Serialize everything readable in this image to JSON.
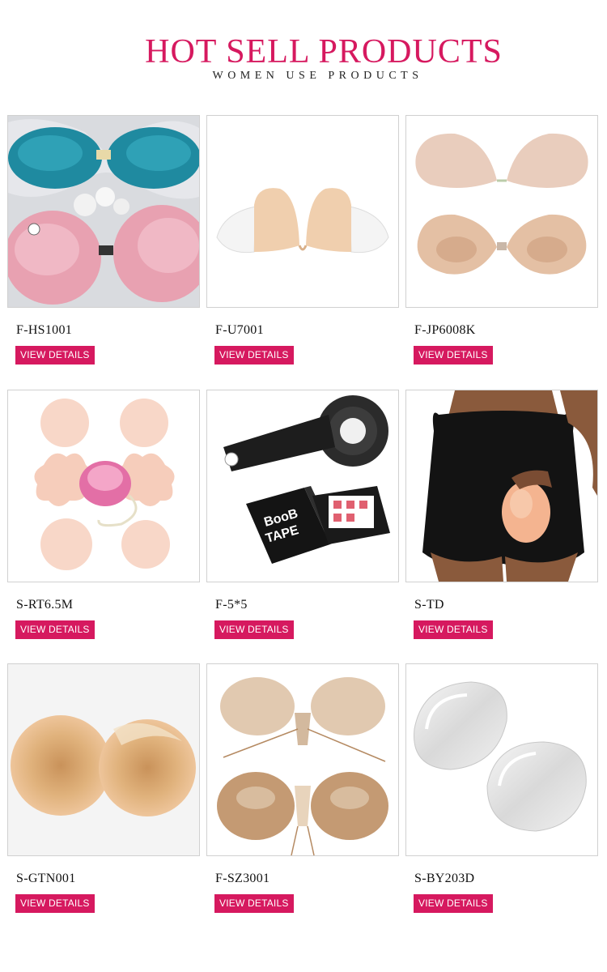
{
  "header": {
    "title": "HOT SELL PRODUCTS",
    "subtitle": "WOMEN USE PRODUCTS"
  },
  "colors": {
    "accent": "#d6195f"
  },
  "products": [
    {
      "code": "F-HS1001",
      "button": "VIEW DETAILS",
      "image": "teal-and-pink-adhesive-bras"
    },
    {
      "code": "F-U7001",
      "button": "VIEW DETAILS",
      "image": "nude-u-plunge-bra"
    },
    {
      "code": "F-JP6008K",
      "button": "VIEW DETAILS",
      "image": "nude-front-clasp-bra"
    },
    {
      "code": "S-RT6.5M",
      "button": "VIEW DETAILS",
      "image": "silicone-nipple-covers-with-case"
    },
    {
      "code": "F-5*5",
      "button": "VIEW DETAILS",
      "image": "black-boob-tape-roll",
      "box_text": [
        "BooB",
        "TAPE"
      ]
    },
    {
      "code": "S-TD",
      "button": "VIEW DETAILS",
      "image": "padded-shorts-with-silicone-pad"
    },
    {
      "code": "S-GTN001",
      "button": "VIEW DETAILS",
      "image": "silicone-nipple-covers"
    },
    {
      "code": "F-SZ3001",
      "button": "VIEW DETAILS",
      "image": "drawstring-adhesive-bra"
    },
    {
      "code": "S-BY203D",
      "button": "VIEW DETAILS",
      "image": "clear-silicone-inserts"
    }
  ]
}
